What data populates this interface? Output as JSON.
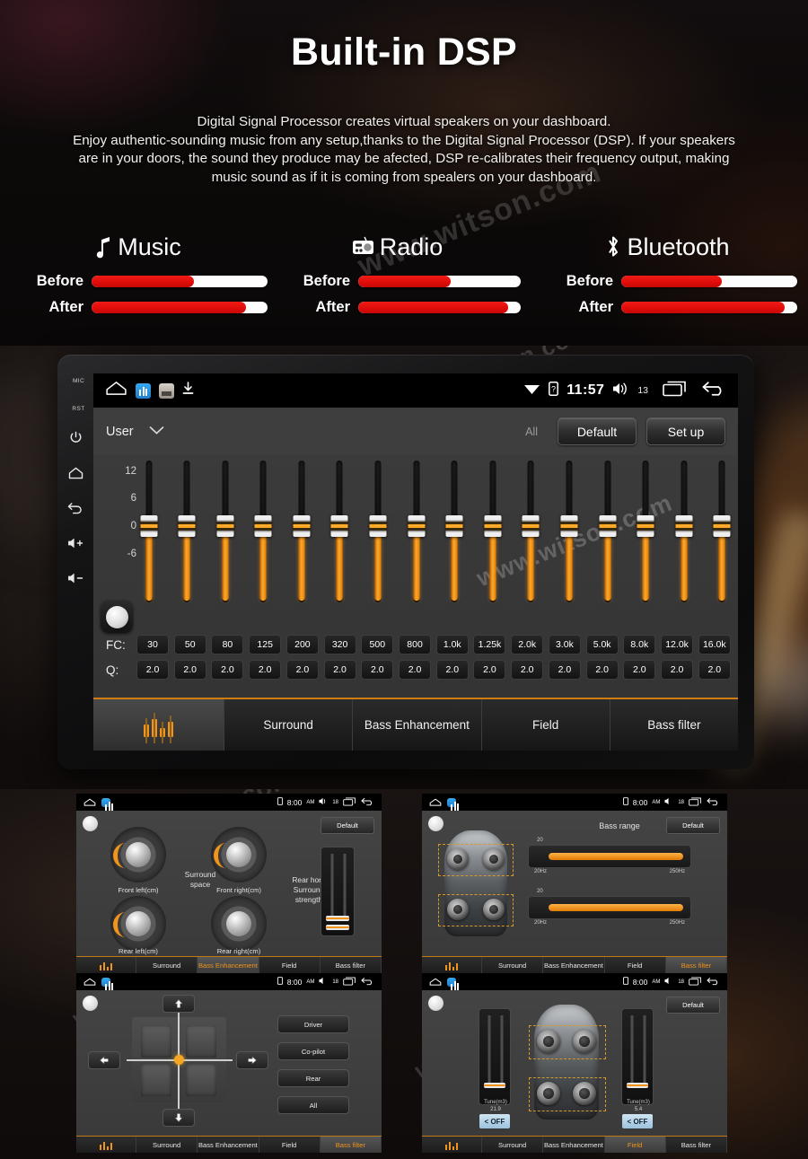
{
  "hero": {
    "title": "Built-in DSP",
    "description": "Digital Signal Processor creates virtual speakers on your dashboard.\nEnjoy authentic-sounding music from any setup,thanks to the Digital Signal Processor (DSP). If your speakers are in your doors, the sound they produce may be afected, DSP re-calibrates their frequency output, making music sound as if it is coming from spealers on your dashboard."
  },
  "comparison": {
    "before_label": "Before",
    "after_label": "After",
    "bar_fill_color": "#e00d0a",
    "bar_track_color": "#fdfdfd",
    "columns": [
      {
        "name": "Music",
        "icon": "music-note-icon",
        "before": 58,
        "after": 88
      },
      {
        "name": "Radio",
        "icon": "radio-icon",
        "before": 57,
        "after": 92
      },
      {
        "name": "Bluetooth",
        "icon": "bluetooth-icon",
        "before": 57,
        "after": 93
      }
    ]
  },
  "device": {
    "side_buttons": [
      {
        "label": "MIC",
        "name": "mic-pin"
      },
      {
        "label": "RST",
        "name": "reset-pin"
      },
      {
        "label": "",
        "name": "power-button"
      },
      {
        "label": "",
        "name": "home-button"
      },
      {
        "label": "",
        "name": "back-button"
      },
      {
        "label": "",
        "name": "volume-up-button"
      },
      {
        "label": "",
        "name": "volume-down-button"
      }
    ],
    "statusbar": {
      "clock": "11:57",
      "volume": "13",
      "icons": [
        "home-icon",
        "recorder-app-icon",
        "file-app-icon",
        "download-icon",
        "wifi-icon",
        "sim-icon",
        "volume-icon",
        "recents-icon",
        "back-icon"
      ]
    },
    "preset": {
      "user_label": "User",
      "all_label": "All",
      "default_label": "Default",
      "setup_label": "Set up"
    },
    "eq": {
      "axis_labels": [
        "12",
        "6",
        "0",
        "-6"
      ],
      "fc_key": "FC:",
      "q_key": "Q:",
      "frequencies": [
        "30",
        "50",
        "80",
        "125",
        "200",
        "320",
        "500",
        "800",
        "1.0k",
        "1.25k",
        "2.0k",
        "3.0k",
        "5.0k",
        "8.0k",
        "12.0k",
        "16.0k"
      ],
      "q_values": [
        "2.0",
        "2.0",
        "2.0",
        "2.0",
        "2.0",
        "2.0",
        "2.0",
        "2.0",
        "2.0",
        "2.0",
        "2.0",
        "2.0",
        "2.0",
        "2.0",
        "2.0",
        "2.0"
      ],
      "gains": [
        0,
        0,
        0,
        0,
        0,
        0,
        0,
        0,
        0,
        0,
        0,
        0,
        0,
        0,
        0,
        0
      ],
      "accent_color": "#f0941c"
    },
    "tabs": [
      {
        "label": "",
        "icon": "equalizer-icon",
        "active": true
      },
      {
        "label": "Surround",
        "active": false
      },
      {
        "label": "Bass Enhancement",
        "active": false
      },
      {
        "label": "Field",
        "active": false
      },
      {
        "label": "Bass filter",
        "active": false
      }
    ]
  },
  "thumbnails": [
    {
      "id": "surround-screen",
      "statusbar": {
        "clock": "8:00",
        "ampm": "AM",
        "volume": "18"
      },
      "default_label": "Default",
      "active_tab": "Bass Enhancement",
      "tabs": [
        "",
        "Surround",
        "Bass Enhancement",
        "Field",
        "Bass filter"
      ],
      "knobs": [
        {
          "label": "Front left(cm)"
        },
        {
          "label": "Front right(cm)"
        },
        {
          "label": "Rear left(cm)"
        },
        {
          "label": "Rear right(cm)"
        }
      ],
      "center_label": "Surround\nspace",
      "right_label": "Rear horn\nSurround\nstrength"
    },
    {
      "id": "bass-filter-screen",
      "statusbar": {
        "clock": "8:00",
        "ampm": "AM",
        "volume": "18"
      },
      "default_label": "Default",
      "active_tab": "Bass filter",
      "tabs": [
        "",
        "Surround",
        "Bass Enhancement",
        "Field",
        "Bass filter"
      ],
      "section_title": "Bass range",
      "sliders": [
        {
          "value": "20",
          "min": "20Hz",
          "max": "250Hz"
        },
        {
          "value": "20",
          "min": "20Hz",
          "max": "250Hz"
        }
      ]
    },
    {
      "id": "field-position-screen",
      "statusbar": {
        "clock": "8:00",
        "ampm": "AM",
        "volume": "18"
      },
      "active_tab": "Bass filter",
      "tabs": [
        "",
        "Surround",
        "Bass Enhancement",
        "Field",
        "Bass filter"
      ],
      "position_buttons": [
        "Driver",
        "Co-pilot",
        "Rear",
        "All"
      ],
      "arrows": [
        "up-arrow-icon",
        "left-arrow-icon",
        "right-arrow-icon",
        "down-arrow-icon"
      ]
    },
    {
      "id": "field-screen",
      "statusbar": {
        "clock": "8:00",
        "ampm": "AM",
        "volume": "18"
      },
      "default_label": "Default",
      "active_tab": "Field",
      "tabs": [
        "",
        "Surround",
        "Bass Enhancement",
        "Field",
        "Bass filter"
      ],
      "fader_label": "Tune(m3)",
      "off_label": "< OFF",
      "fader_top": "21.9",
      "fader_bottom": "5.4"
    }
  ],
  "watermark": "www.witson.com"
}
